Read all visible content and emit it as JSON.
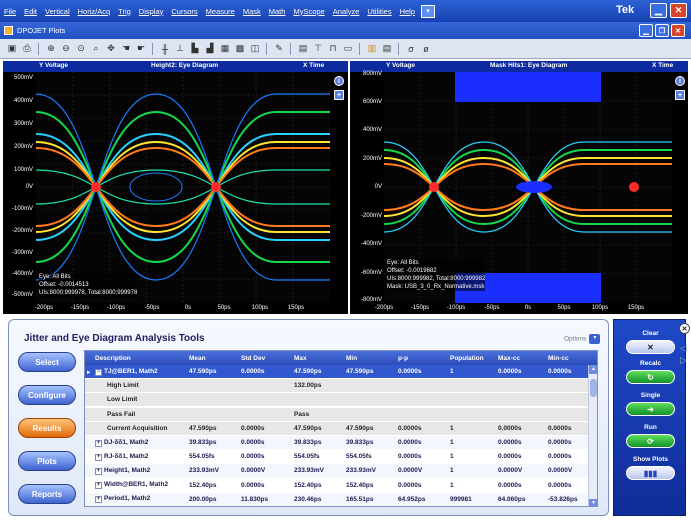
{
  "menu": {
    "items": [
      "File",
      "Edit",
      "Vertical",
      "Horiz/Acq",
      "Trig",
      "Display",
      "Cursors",
      "Measure",
      "Mask",
      "Math",
      "MyScope",
      "Analyze",
      "Utilities",
      "Help"
    ],
    "brand": "Tek"
  },
  "window": {
    "title": "DPOJET Plots"
  },
  "plots": [
    {
      "y_axis": "Y Voltage",
      "title": "Height2: Eye Diagram",
      "x_axis": "X Time",
      "y_ticks": [
        "500mV",
        "400mV",
        "300mV",
        "200mV",
        "100mV",
        "0V",
        "-100mV",
        "-200mV",
        "-300mV",
        "-400mV",
        "-500mV"
      ],
      "x_ticks": [
        "-200ps",
        "-150ps",
        "-100ps",
        "-50ps",
        "0s",
        "50ps",
        "100ps",
        "150ps"
      ],
      "legend": [
        "Eye: All Bits",
        "Offset: -0.0014513",
        "UIs:8000:999978, Total:8000:999978"
      ]
    },
    {
      "y_axis": "Y Voltage",
      "title": "Mask Hits1: Eye Diagram",
      "x_axis": "X Time",
      "y_ticks": [
        "800mV",
        "600mV",
        "400mV",
        "200mV",
        "0V",
        "-200mV",
        "-400mV",
        "-600mV",
        "-800mV"
      ],
      "x_ticks": [
        "-200ps",
        "-150ps",
        "-100ps",
        "-50ps",
        "0s",
        "50ps",
        "100ps",
        "150ps"
      ],
      "legend": [
        "Eye: All Bits",
        "Offset: -0.0019682",
        "UIs:8000:999982, Total:8000:999982",
        "Mask: USB_3_0_Rx_Normative.msk"
      ]
    }
  ],
  "panel": {
    "title": "Jitter and Eye Diagram Analysis Tools",
    "options_label": "Options",
    "nav": [
      "Select",
      "Configure",
      "Results",
      "Plots",
      "Reports"
    ],
    "columns": [
      "Description",
      "Mean",
      "Std Dev",
      "Max",
      "Min",
      "p-p",
      "Population",
      "Max-cc",
      "Min-cc"
    ],
    "rows": [
      {
        "kind": "selected",
        "toggle": "⊟",
        "cells": [
          "TJ@BER1, Math2",
          "47.590ps",
          "0.0000s",
          "47.590ps",
          "47.590ps",
          "0.0000s",
          "1",
          "0.0000s",
          "0.0000s"
        ]
      },
      {
        "kind": "sub",
        "cells": [
          "High Limit",
          "",
          "",
          "132.00ps",
          "",
          "",
          "",
          "",
          ""
        ]
      },
      {
        "kind": "sub",
        "cells": [
          "Low Limit",
          "",
          "",
          "",
          "",
          "",
          "",
          "",
          ""
        ]
      },
      {
        "kind": "sub",
        "cells": [
          "Pass Fail",
          "",
          "",
          "Pass",
          "",
          "",
          "",
          "",
          ""
        ]
      },
      {
        "kind": "sub",
        "cells": [
          "Current Acquisition",
          "47.590ps",
          "0.0000s",
          "47.590ps",
          "47.590ps",
          "0.0000s",
          "1",
          "0.0000s",
          "0.0000s"
        ]
      },
      {
        "kind": "normal",
        "toggle": "+",
        "cells": [
          "DJ-δδ1, Math2",
          "39.833ps",
          "0.0000s",
          "39.833ps",
          "39.833ps",
          "0.0000s",
          "1",
          "0.0000s",
          "0.0000s"
        ]
      },
      {
        "kind": "normal",
        "toggle": "+",
        "cells": [
          "RJ-δδ1, Math2",
          "554.05fs",
          "0.0000s",
          "554.05fs",
          "554.05fs",
          "0.0000s",
          "1",
          "0.0000s",
          "0.0000s"
        ]
      },
      {
        "kind": "normal",
        "toggle": "+",
        "cells": [
          "Height1, Math2",
          "233.93mV",
          "0.0000V",
          "233.93mV",
          "233.93mV",
          "0.0000V",
          "1",
          "0.0000V",
          "0.0000V"
        ]
      },
      {
        "kind": "normal",
        "toggle": "+",
        "cells": [
          "Width@BER1, Math2",
          "152.40ps",
          "0.0000s",
          "152.40ps",
          "152.40ps",
          "0.0000s",
          "1",
          "0.0000s",
          "0.0000s"
        ]
      },
      {
        "kind": "normal",
        "toggle": "+",
        "cells": [
          "Period1, Math2",
          "200.00ps",
          "11.830ps",
          "230.46ps",
          "165.51ps",
          "64.952ps",
          "999981",
          "64.060ps",
          "-53.826ps"
        ]
      }
    ]
  },
  "right_panel": {
    "clear_label": "Clear",
    "recalc_label": "Recalc",
    "single_label": "Single",
    "run_label": "Run",
    "show_plots_label": "Show Plots"
  },
  "colors": {
    "accent": "#2150c0",
    "active_nav": "#e06b0b",
    "mask": "#1a2fff"
  }
}
